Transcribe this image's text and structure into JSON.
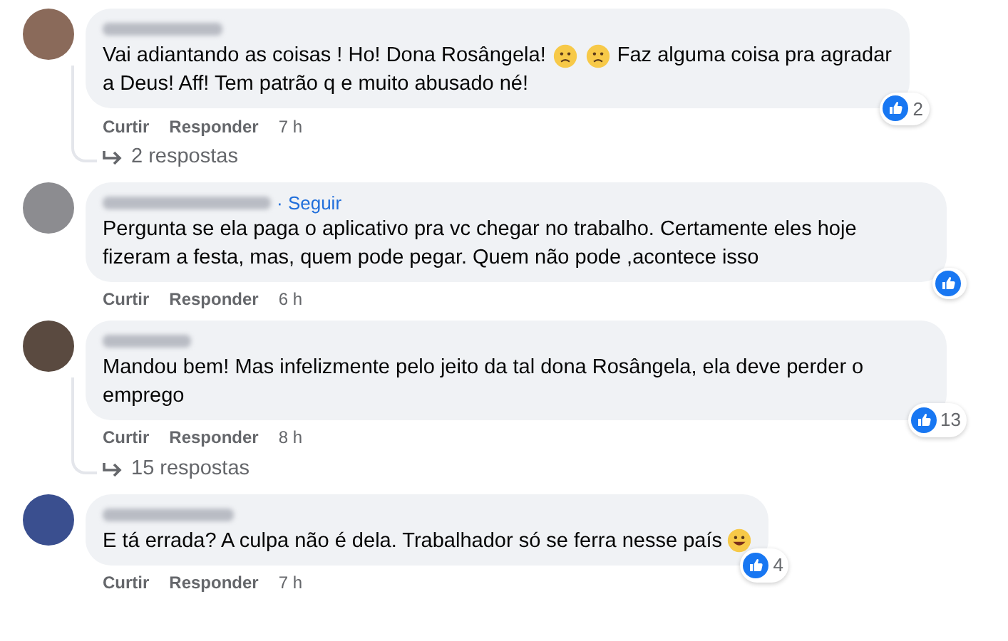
{
  "comments": [
    {
      "lines": [
        [
          {
            "kind": "text",
            "text": "Vai adiantando as coisas ! Ho! Dona Rosângela!"
          },
          {
            "kind": "sad-emoji"
          },
          {
            "kind": "sad-emoji"
          },
          {
            "kind": "text",
            "text": "Faz alguma coisa pra agradar"
          }
        ],
        [
          {
            "kind": "text",
            "text": "a Deus! Aff! Tem patrão q e muito abusado né!"
          }
        ]
      ],
      "actions": [
        "Curtir",
        "Responder"
      ],
      "time": "7 h",
      "reactions": "2",
      "replies": "2 respostas"
    },
    {
      "follow": "· Seguir",
      "lines": [
        [
          {
            "kind": "text",
            "text": "Pergunta se ela paga o aplicativo pra vc chegar no trabalho. Certamente eles hoje fizeram a festa, mas, quem pode pegar. Quem não pode ,acontece isso"
          }
        ]
      ],
      "actions": [
        "Curtir",
        "Responder"
      ],
      "time": "6 h"
    },
    {
      "lines": [
        [
          {
            "kind": "text",
            "text": "Mandou bem! Mas infelizmente pelo jeito da tal dona Rosângela, ela deve perder o emprego"
          }
        ]
      ],
      "actions": [
        "Curtir",
        "Responder"
      ],
      "time": "8 h",
      "reactions": "13",
      "replies": "15 respostas"
    },
    {
      "lines": [
        [
          {
            "kind": "text",
            "text": "E tá errada? A culpa não é dela. Trabalhador só se ferra nesse país"
          },
          {
            "kind": "grin-emoji"
          }
        ]
      ],
      "actions": [
        "Curtir",
        "Responder"
      ],
      "time": "7 h",
      "reactions": "4"
    }
  ]
}
